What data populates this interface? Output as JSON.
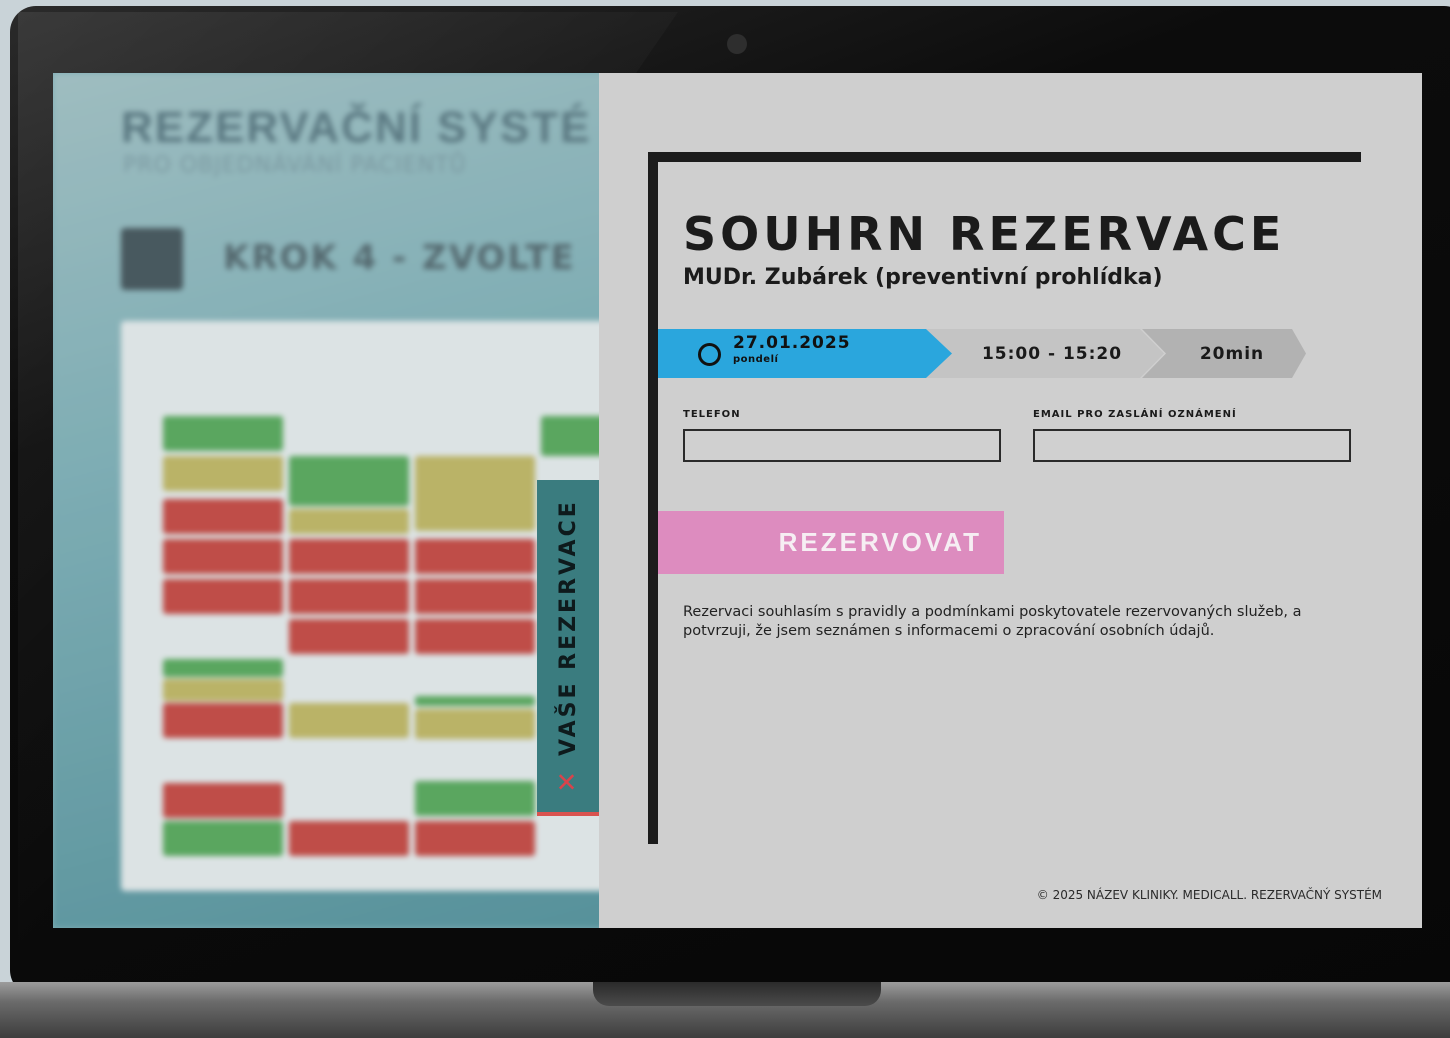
{
  "background_app": {
    "title": "REZERVAČNÍ SYSTÉ",
    "subtitle": "PRO OBJEDNÁVÁNÍ PACIENTŮ",
    "step": "KROK 4 - ZVOLTE"
  },
  "side_tab": {
    "label": "VAŠE REZERVACE",
    "close_icon": "close-icon",
    "color": "#3a7c7f",
    "close_color": "#d9434b"
  },
  "summary": {
    "title": "SOUHRN REZERVACE",
    "doctor": "MUDr. Zubárek (preventivní prohlídka)",
    "date": "27.01.2025",
    "day": "pondelí",
    "time": "15:00 - 15:20",
    "duration": "20min",
    "accent_color": "#2aa6dd"
  },
  "form": {
    "phone_label": "TELEFON",
    "phone_value": "",
    "email_label": "EMAIL PRO ZASLÁNÍ OZNÁMENÍ",
    "email_value": ""
  },
  "reserve_button": {
    "label": "REZERVOVAT",
    "color": "#dd8cbf"
  },
  "consent_text": "Rezervaci souhlasím s pravidly a podmínkami poskytovatele rezervovaných služeb, a potvrzuji, že jsem seznámen s informacemi o zpracování osobních údajů.",
  "footer": "© 2025 NÁZEV KLINIKY. MEDICALL. REZERVAČNÝ SYSTÉM"
}
